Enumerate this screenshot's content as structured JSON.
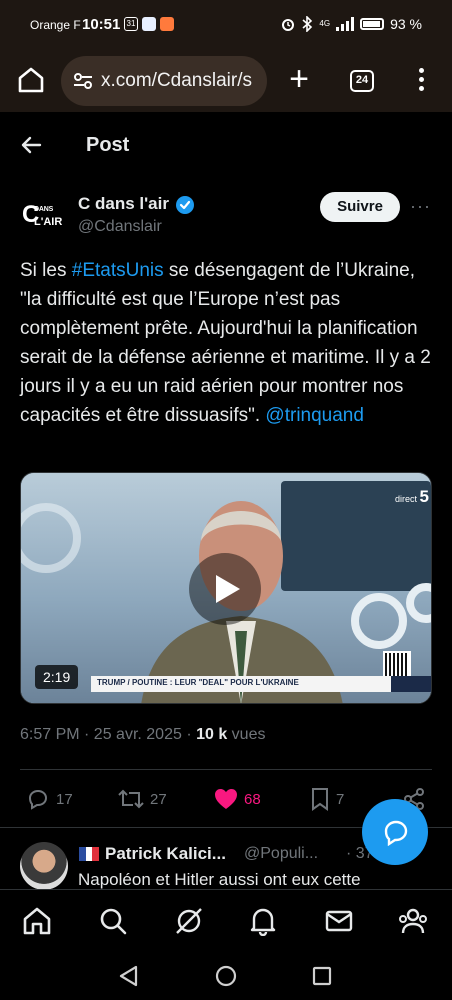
{
  "status_bar": {
    "carrier": "Orange F",
    "time": "10:51",
    "battery": "93 %",
    "network": "4G"
  },
  "browser": {
    "url": "x.com/Cdanslair/s",
    "tab_count": "24"
  },
  "header": {
    "title": "Post"
  },
  "author": {
    "name": "C dans l'air",
    "handle": "@Cdanslair",
    "logo_line1": "DANS",
    "logo_line2": "L'AIR",
    "logo_letter": "C",
    "follow_label": "Suivre",
    "verified_color": "#1d9bf0"
  },
  "tweet": {
    "part1": "Si les ",
    "hashtag": "#EtatsUnis",
    "part2": " se désengagent de l’Ukraine, \"la difficulté est que l’Europe n’est pas complètement prête. Aujourd'hui la planification serait de la défense aérienne et maritime. Il y a 2 jours il y a eu un raid aérien pour montrer nos capacités et être dissuasifs\". ",
    "mention": "@trinquand"
  },
  "video": {
    "duration": "2:19",
    "banner_text": "TRUMP / POUTINE : LEUR \"DEAL\" POUR L'UKRAINE",
    "channel_prefix": "direct",
    "channel_number": "5"
  },
  "meta": {
    "time_date": "6:57 PM · 25 avr. 2025 · ",
    "views_count": "10 k",
    "views_label": " vues"
  },
  "actions": {
    "replies": "17",
    "reposts": "27",
    "likes": "68",
    "bookmarks": "7"
  },
  "reply": {
    "name": "Patrick Kalici...",
    "handle": "@Populi...",
    "time": "· 37 n",
    "text": "Napoléon et Hitler aussi ont eux cette"
  },
  "colors": {
    "accent": "#1d9bf0",
    "like": "#f91880",
    "background": "#000000",
    "muted": "#71767b"
  }
}
